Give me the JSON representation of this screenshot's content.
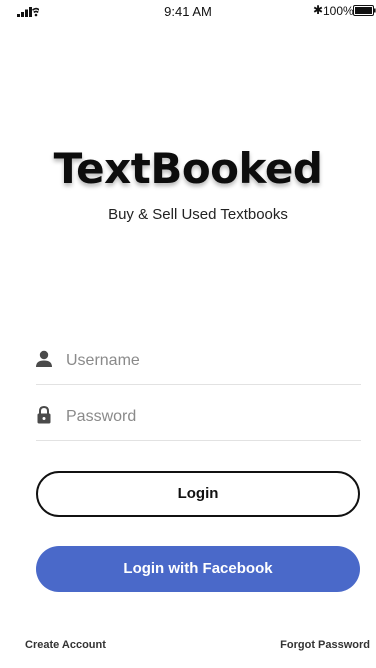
{
  "status_bar": {
    "time": "9:41 AM",
    "battery": "100%",
    "icons": [
      "signal-icon",
      "wifi-icon",
      "bluetooth-icon",
      "battery-icon"
    ]
  },
  "brand": {
    "title": "TextBooked",
    "tagline": "Buy & Sell Used Textbooks"
  },
  "form": {
    "username_placeholder": "Username",
    "username_value": "",
    "password_placeholder": "Password",
    "password_value": "",
    "username_icon": "user-icon",
    "password_icon": "lock-icon"
  },
  "buttons": {
    "login": "Login",
    "facebook": "Login with Facebook"
  },
  "footer": {
    "create_account": "Create Account",
    "forgot_password": "Forgot Password"
  },
  "colors": {
    "facebook_blue": "#4a69c9",
    "text_dark": "#111111",
    "placeholder_gray": "#8a8a8a"
  }
}
